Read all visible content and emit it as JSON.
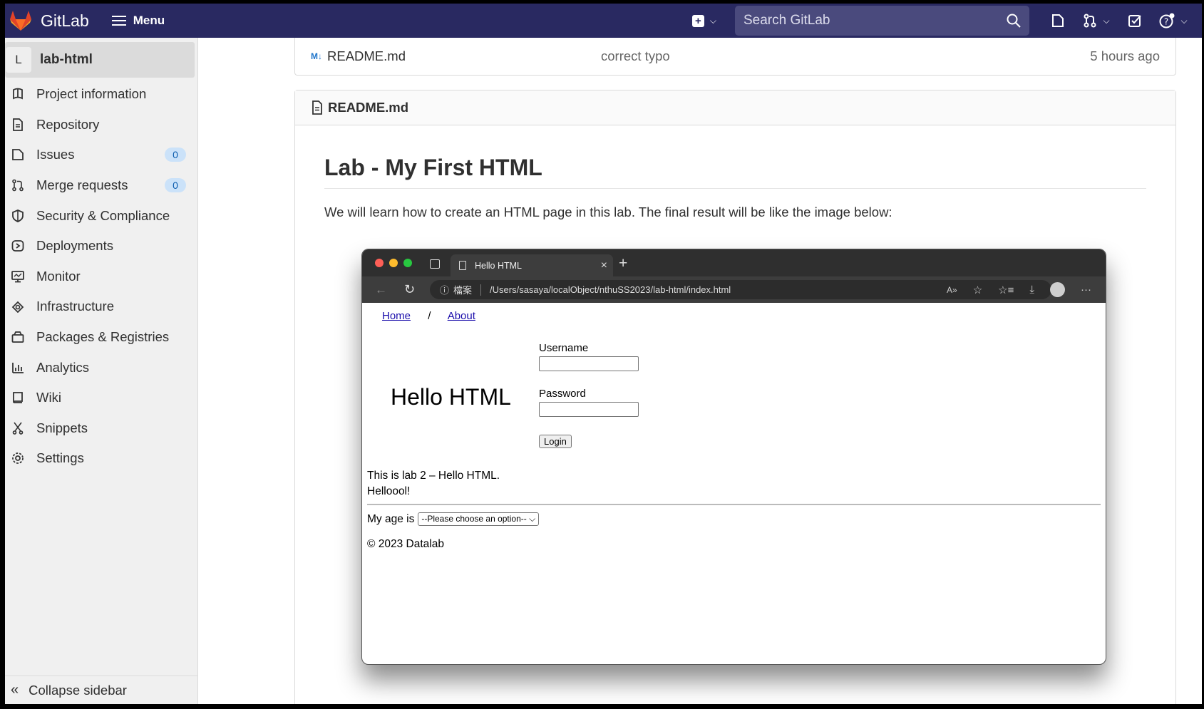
{
  "navbar": {
    "brand": "GitLab",
    "menu_label": "Menu",
    "search_placeholder": "Search GitLab"
  },
  "sidebar": {
    "project_avatar": "L",
    "project_name": "lab-html",
    "items": [
      {
        "label": "Project information",
        "icon": "info-icon"
      },
      {
        "label": "Repository",
        "icon": "document-icon"
      },
      {
        "label": "Issues",
        "icon": "issues-icon",
        "badge": "0"
      },
      {
        "label": "Merge requests",
        "icon": "merge-request-icon",
        "badge": "0"
      },
      {
        "label": "Security & Compliance",
        "icon": "shield-icon"
      },
      {
        "label": "Deployments",
        "icon": "rocket-icon"
      },
      {
        "label": "Monitor",
        "icon": "monitor-icon"
      },
      {
        "label": "Infrastructure",
        "icon": "cloud-gear-icon"
      },
      {
        "label": "Packages & Registries",
        "icon": "package-icon"
      },
      {
        "label": "Analytics",
        "icon": "chart-icon"
      },
      {
        "label": "Wiki",
        "icon": "book-icon"
      },
      {
        "label": "Snippets",
        "icon": "scissors-icon"
      },
      {
        "label": "Settings",
        "icon": "gear-icon"
      }
    ],
    "collapse_label": "Collapse sidebar"
  },
  "file_row": {
    "icon_text": "M↓",
    "name": "README.md",
    "commit": "correct typo",
    "time": "5 hours ago"
  },
  "readme": {
    "header": "README.md",
    "title": "Lab - My First HTML",
    "intro": "We will learn how to create an HTML page in this lab. The final result will be like the image below:"
  },
  "screenshot": {
    "tab_title": "Hello HTML",
    "url_label": "檔案",
    "url": "/Users/sasaya/localObject/nthuSS2023/lab-html/index.html",
    "nav_home": "Home",
    "nav_sep": "/",
    "nav_about": "About",
    "heading": "Hello HTML",
    "username_label": "Username",
    "password_label": "Password",
    "login_label": "Login",
    "text_line1": "This is lab 2 – Hello HTML.",
    "text_line2": "Helloool!",
    "age_label": "My age is",
    "age_select": "--Please choose an option--",
    "copyright": "© 2023 Datalab"
  },
  "colors": {
    "navbar_bg": "#292961",
    "sidebar_bg": "#f0f0f0",
    "badge_bg": "#cbe2f9"
  }
}
